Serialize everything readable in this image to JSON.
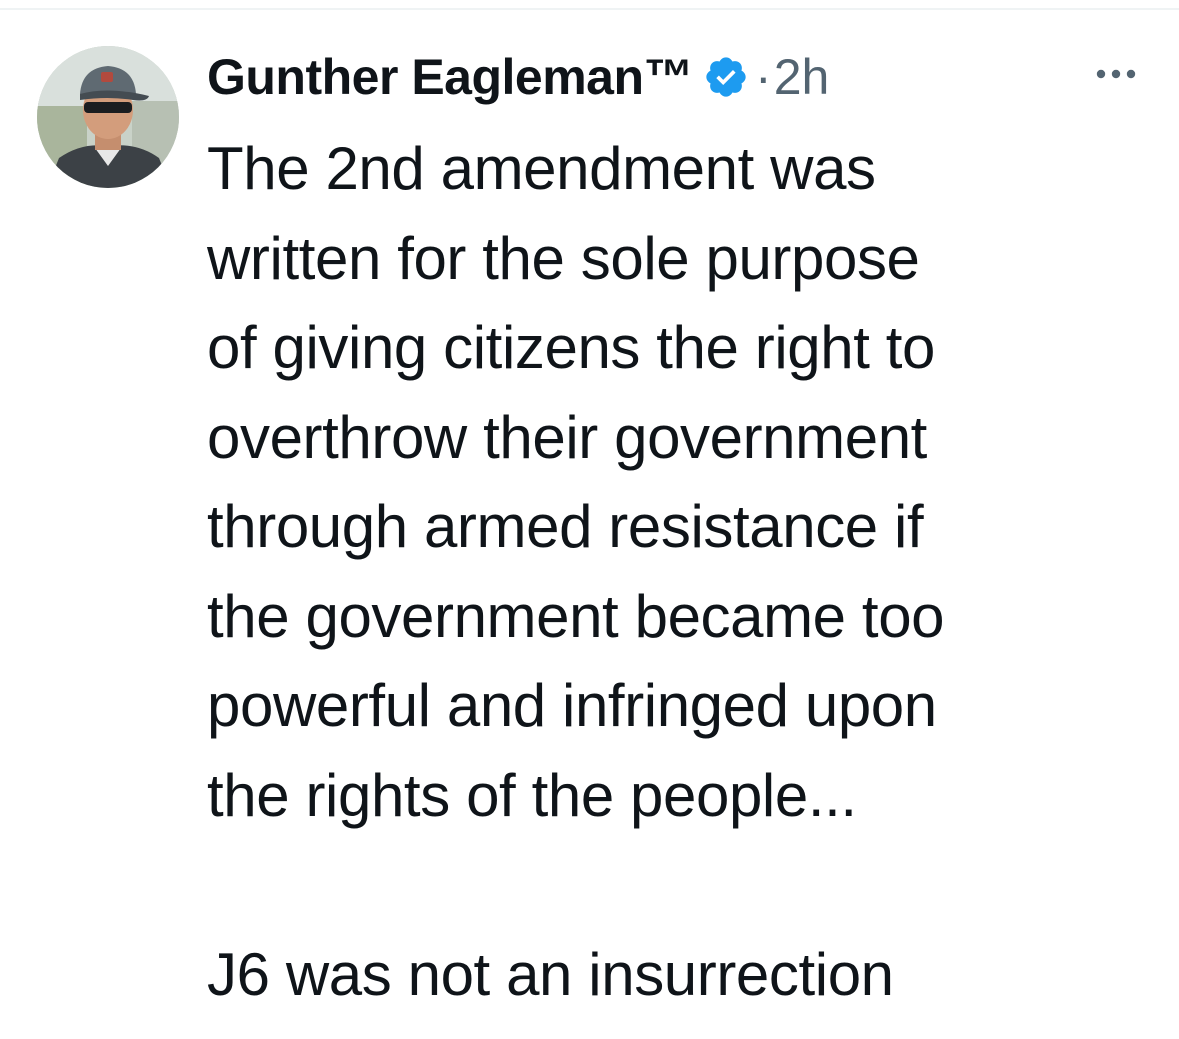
{
  "tweet": {
    "author": {
      "display_name": "Gunther Eagleman™",
      "verified": true,
      "avatar_icon": "profile-photo",
      "verified_icon": "verified-badge-icon",
      "verified_color": "#1d9bf0"
    },
    "separator": "·",
    "timestamp": "2h",
    "more_icon": "more-horizontal-icon",
    "text_lines": [
      "The 2nd amendment was",
      "written for the sole purpose",
      "of giving citizens the right to",
      "overthrow their government",
      "through armed resistance if",
      "the government became too",
      "powerful and infringed upon",
      "the rights of the people..."
    ],
    "text_closing": "J6 was not an insurrection"
  }
}
